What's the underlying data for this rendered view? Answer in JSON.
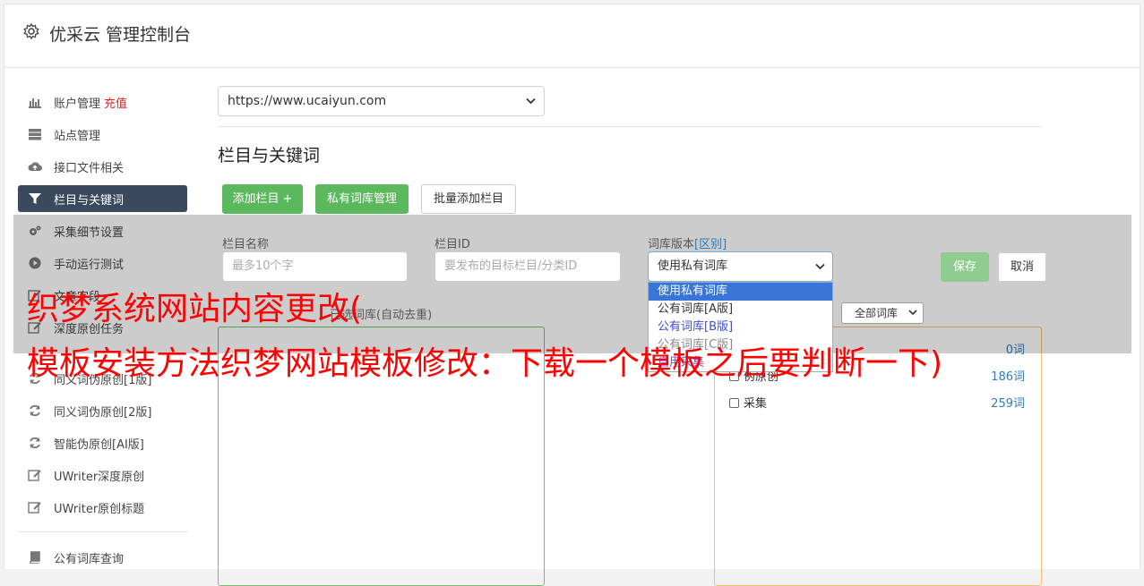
{
  "header": {
    "title": "优采云 管理控制台"
  },
  "sidebar": {
    "items": [
      {
        "label": "账户管理",
        "extra": "充值",
        "icon": "bar-chart-icon"
      },
      {
        "label": "站点管理",
        "icon": "server-icon"
      },
      {
        "label": "接口文件相关",
        "icon": "cloud-upload-icon"
      },
      {
        "label": "栏目与关键词",
        "icon": "filter-icon",
        "active": true
      },
      {
        "label": "采集细节设置",
        "icon": "cogs-icon"
      },
      {
        "label": "手动运行测试",
        "icon": "play-circle-icon"
      },
      {
        "label": "文章字段",
        "icon": "edit-icon"
      },
      {
        "label": "深度原创任务",
        "icon": "edit-icon"
      },
      {
        "label": "同义词伪原创[1版]",
        "icon": "refresh-icon"
      },
      {
        "label": "同义词伪原创[2版]",
        "icon": "refresh-icon"
      },
      {
        "label": "智能伪原创[AI版]",
        "icon": "refresh-icon"
      },
      {
        "label": "UWriter深度原创",
        "icon": "edit-icon"
      },
      {
        "label": "UWriter原创标题",
        "icon": "edit-icon"
      },
      {
        "label": "公有词库查询",
        "icon": "book-icon"
      }
    ]
  },
  "main": {
    "site_select": "https://www.ucaiyun.com",
    "section_title": "栏目与关键词",
    "buttons": {
      "add_column": "添加栏目 +",
      "private_lib": "私有词库管理",
      "batch_add": "批量添加栏目"
    },
    "form": {
      "name_label": "栏目名称",
      "name_placeholder": "最多10个字",
      "id_label": "栏目ID",
      "id_placeholder": "要发布的目标栏目/分类ID",
      "version_label": "词库版本",
      "version_link": "[区别]",
      "version_selected": "使用私有词库",
      "save": "保存",
      "cancel": "取消"
    },
    "dropdown_options": [
      "使用私有词库",
      "公有词库[A版]",
      "公有词库[B版]",
      "公有词库[C版]",
      "启用采集"
    ],
    "selected_label_text": "已选词库(自动去重)",
    "lib_filter": "全部词库",
    "lib_rows": [
      {
        "label": "伪原创",
        "count": "186词"
      },
      {
        "label": "采集",
        "count": "259词"
      }
    ],
    "partial_count": "0词"
  },
  "caption": {
    "line1": "织梦系统网站内容更改(",
    "line2": "模板安装方法织梦网站模板修改：下载一个模板之后要判断一下)"
  }
}
